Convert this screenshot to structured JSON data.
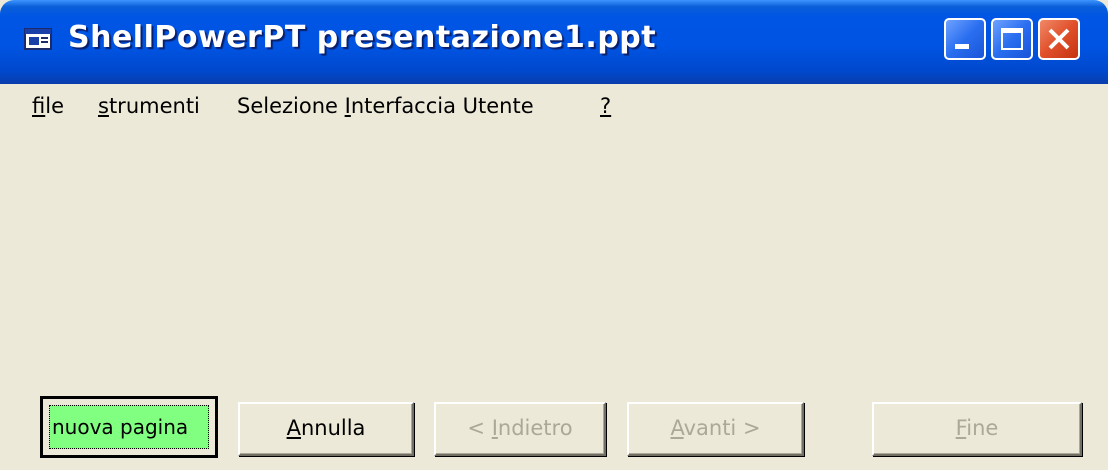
{
  "window": {
    "title": "ShellPowerPT presentazione1.ppt",
    "icon": "app-window-icon",
    "controls": {
      "minimize_icon": "minimize-icon",
      "maximize_icon": "maximize-icon",
      "close_icon": "close-icon"
    },
    "colors": {
      "titlebar": "#0054e3",
      "close_button": "#e0502a",
      "body": "#ece9d8"
    }
  },
  "menubar": {
    "items": [
      {
        "accel": "f",
        "rest": "ile"
      },
      {
        "accel": "s",
        "rest": "trumenti"
      },
      {
        "pre": "Selezione ",
        "accel": "I",
        "rest": "nterfaccia Utente"
      },
      {
        "accel": "?",
        "rest": ""
      }
    ]
  },
  "buttons": {
    "new_page": {
      "label": "nuova pagina",
      "color": "#80ff80"
    },
    "cancel": {
      "accel": "A",
      "rest": "nnulla"
    },
    "back": {
      "pre": "< ",
      "accel": "I",
      "rest": "ndietro",
      "enabled": false
    },
    "next": {
      "accel": "A",
      "rest": "vanti >",
      "enabled": false
    },
    "finish": {
      "accel": "F",
      "rest": "ine",
      "enabled": false
    }
  }
}
